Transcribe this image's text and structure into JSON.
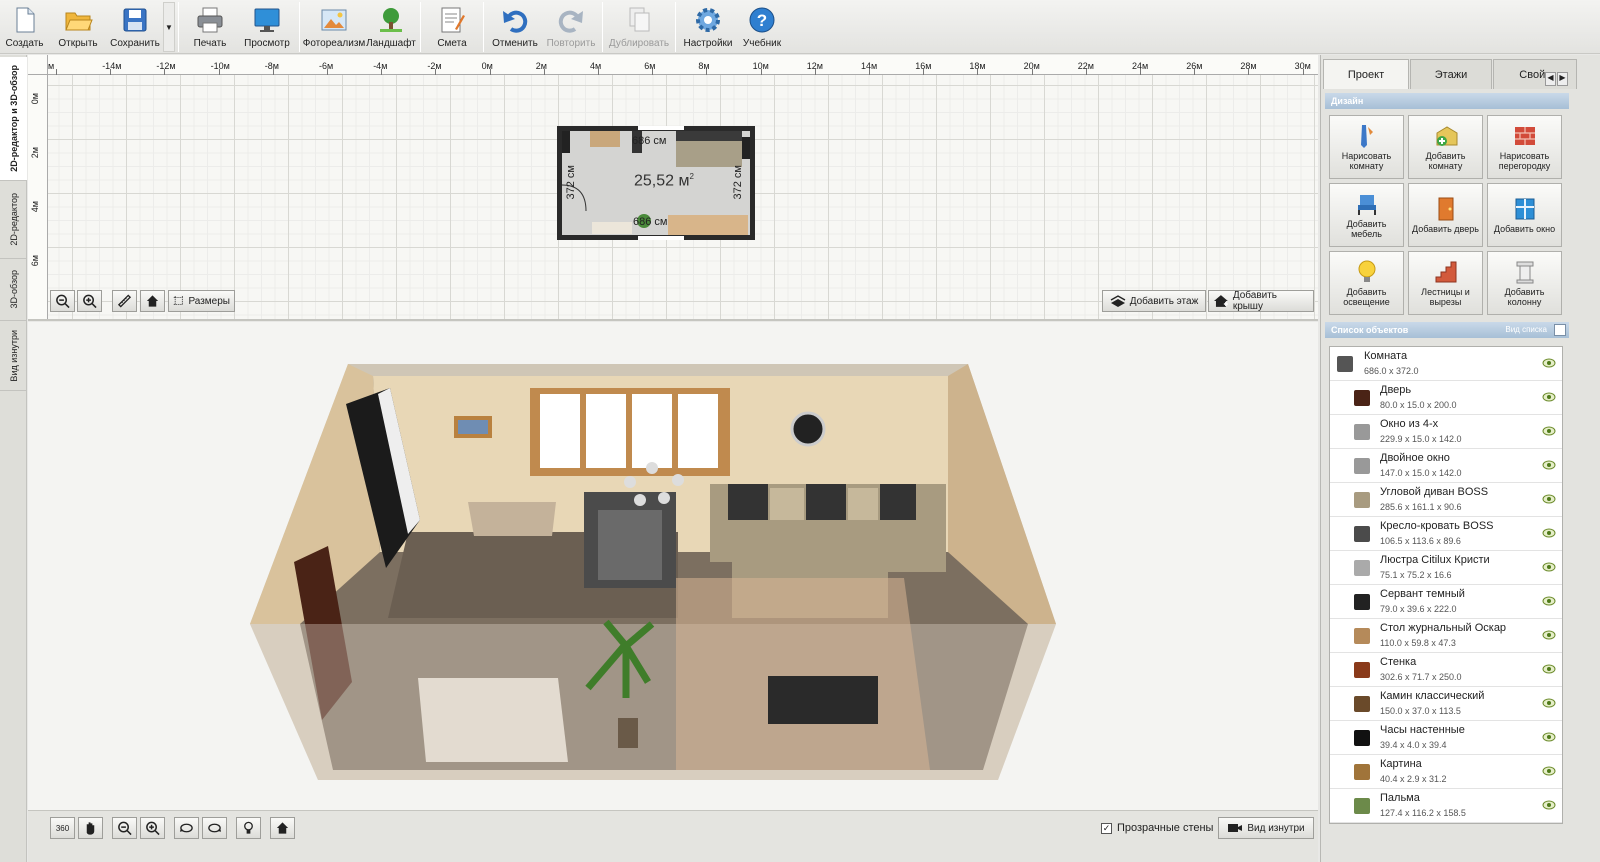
{
  "toolbar": {
    "buttons": [
      {
        "label": "Создать",
        "icon": "new-file-icon"
      },
      {
        "label": "Открыть",
        "icon": "folder-open-icon"
      },
      {
        "label": "Сохранить",
        "icon": "save-icon"
      },
      {
        "label": "Печать",
        "icon": "printer-icon"
      },
      {
        "label": "Просмотр",
        "icon": "monitor-icon"
      },
      {
        "label": "Фотореализм",
        "icon": "photo-icon"
      },
      {
        "label": "Ландшафт",
        "icon": "tree-icon"
      },
      {
        "label": "Смета",
        "icon": "estimate-icon"
      },
      {
        "label": "Отменить",
        "icon": "undo-icon"
      },
      {
        "label": "Повторить",
        "icon": "redo-icon"
      },
      {
        "label": "Дублировать",
        "icon": "duplicate-icon"
      },
      {
        "label": "Настройки",
        "icon": "gear-icon"
      },
      {
        "label": "Учебник",
        "icon": "help-icon"
      }
    ]
  },
  "left_tabs": [
    "2D-редактор и 3D-обзор",
    "2D-редактор",
    "3D-обзор",
    "Вид изнутри"
  ],
  "ruler": {
    "top": [
      "м",
      "-14м",
      "-12м",
      "-10м",
      "-8м",
      "-6м",
      "-4м",
      "-2м",
      "0м",
      "2м",
      "4м",
      "6м",
      "8м",
      "10м",
      "12м",
      "14м",
      "16м",
      "18м",
      "20м",
      "22м",
      "24м",
      "26м",
      "28м",
      "30м"
    ],
    "left": [
      "0м",
      "2м",
      "4м",
      "6м"
    ]
  },
  "plan": {
    "area": "25,52 м",
    "area_sup": "2",
    "dim_top": "686 см",
    "dim_bottom": "686 см",
    "dim_left": "372 см",
    "dim_right": "372 см",
    "sizes_label": "Размеры",
    "add_floor_label": "Добавить этаж",
    "add_roof_label": "Добавить крышу"
  },
  "view3d": {
    "transparent_walls_label": "Прозрачные стены",
    "transparent_walls_checked": true,
    "inside_view_label": "Вид изнутри",
    "rotate_label": "360"
  },
  "right_panel": {
    "tabs": [
      "Проект",
      "Этажи",
      "Свойс"
    ],
    "design_header": "Дизайн",
    "design_buttons": [
      {
        "label": "Нарисовать комнату",
        "icon": "draw-room-icon"
      },
      {
        "label": "Добавить комнату",
        "icon": "add-room-icon"
      },
      {
        "label": "Нарисовать перегородку",
        "icon": "brick-wall-icon"
      },
      {
        "label": "Добавить мебель",
        "icon": "chair-icon"
      },
      {
        "label": "Добавить дверь",
        "icon": "door-icon"
      },
      {
        "label": "Добавить окно",
        "icon": "window-icon"
      },
      {
        "label": "Добавить освещение",
        "icon": "bulb-icon"
      },
      {
        "label": "Лестницы и вырезы",
        "icon": "stairs-icon"
      },
      {
        "label": "Добавить колонну",
        "icon": "column-icon"
      }
    ],
    "objects_header": "Список объектов",
    "list_view_label": "Вид списка",
    "objects": [
      {
        "name": "Комната",
        "dims": "686.0 x 372.0"
      },
      {
        "name": "Дверь",
        "dims": "80.0 x 15.0 x 200.0"
      },
      {
        "name": "Окно из 4-х",
        "dims": "229.9 x 15.0 x 142.0"
      },
      {
        "name": "Двойное окно",
        "dims": "147.0 x 15.0 x 142.0"
      },
      {
        "name": "Угловой диван BOSS",
        "dims": "285.6 x 161.1 x 90.6"
      },
      {
        "name": "Кресло-кровать BOSS",
        "dims": "106.5 x 113.6 x 89.6"
      },
      {
        "name": "Люстра Citilux Кристи",
        "dims": "75.1 x 75.2 x 16.6"
      },
      {
        "name": "Сервант темный",
        "dims": "79.0 x 39.6 x 222.0"
      },
      {
        "name": "Стол журнальный Оскар",
        "dims": "110.0 x 59.8 x 47.3"
      },
      {
        "name": "Стенка",
        "dims": "302.6 x 71.7 x 250.0"
      },
      {
        "name": "Камин классический",
        "dims": "150.0 x 37.0 x 113.5"
      },
      {
        "name": "Часы настенные",
        "dims": "39.4 x 4.0 x 39.4"
      },
      {
        "name": "Картина",
        "dims": "40.4 x 2.9 x 31.2"
      },
      {
        "name": "Пальма",
        "dims": "127.4 x 116.2 x 158.5"
      }
    ]
  },
  "colors": {
    "accent": "#a7bfd6",
    "panel": "#e3e3df",
    "grid": "#d8d8d3"
  }
}
